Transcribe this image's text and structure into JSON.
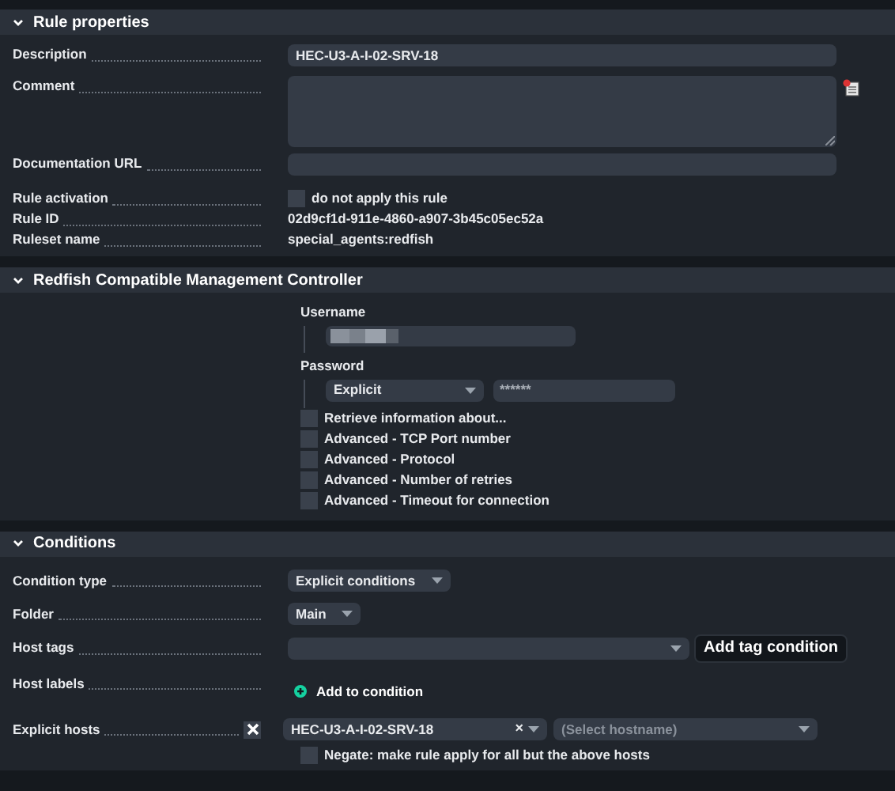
{
  "sections": [
    {
      "title": "Rule properties",
      "expanded": true,
      "rows": [
        {
          "kind": "input",
          "label": "Description",
          "value": "HEC-U3-A-I-02-SRV-18"
        },
        {
          "kind": "textarea",
          "label": "Comment"
        },
        {
          "kind": "input",
          "label": "Documentation URL"
        },
        {
          "kind": "checkbox",
          "label": "Rule activation",
          "text": "do not apply this rule",
          "checked": false
        },
        {
          "kind": "text",
          "label": "Rule ID",
          "text": "02d9cf1d-911e-4860-a907-3b45c05ec52a"
        },
        {
          "kind": "text",
          "label": "Ruleset name",
          "text": "special_agents:redfish"
        }
      ]
    },
    {
      "title": "Redfish Compatible Management Controller",
      "expanded": true,
      "rows": [
        {
          "kind": "username",
          "label": "Username"
        },
        {
          "kind": "password",
          "label": "Password",
          "mode": "Explicit",
          "value": "******"
        },
        {
          "kind": "option",
          "text": "Retrieve information about...",
          "checked": false
        },
        {
          "kind": "option",
          "text": "Advanced - TCP Port number",
          "checked": false
        },
        {
          "kind": "option",
          "text": "Advanced - Protocol",
          "checked": false
        },
        {
          "kind": "option",
          "text": "Advanced - Number of retries",
          "checked": false
        },
        {
          "kind": "option",
          "text": "Advanced - Timeout for connection",
          "checked": false
        }
      ]
    },
    {
      "title": "Conditions",
      "expanded": true,
      "rows": [
        {
          "kind": "select",
          "label": "Condition type",
          "value": "Explicit conditions"
        },
        {
          "kind": "select",
          "label": "Folder",
          "value": "Main"
        },
        {
          "kind": "tags",
          "label": "Host tags",
          "button": "Add tag condition"
        },
        {
          "kind": "add",
          "label": "Host labels",
          "text": "Add to condition"
        },
        {
          "kind": "hosts",
          "label": "Explicit hosts",
          "checked": true,
          "host": "HEC-U3-A-I-02-SRV-18",
          "clear": "×",
          "placeholder": "(Select hostname)",
          "negate": {
            "checked": false,
            "text": "**Negate:** make rule apply for all but the above hosts"
          }
        }
      ]
    }
  ]
}
